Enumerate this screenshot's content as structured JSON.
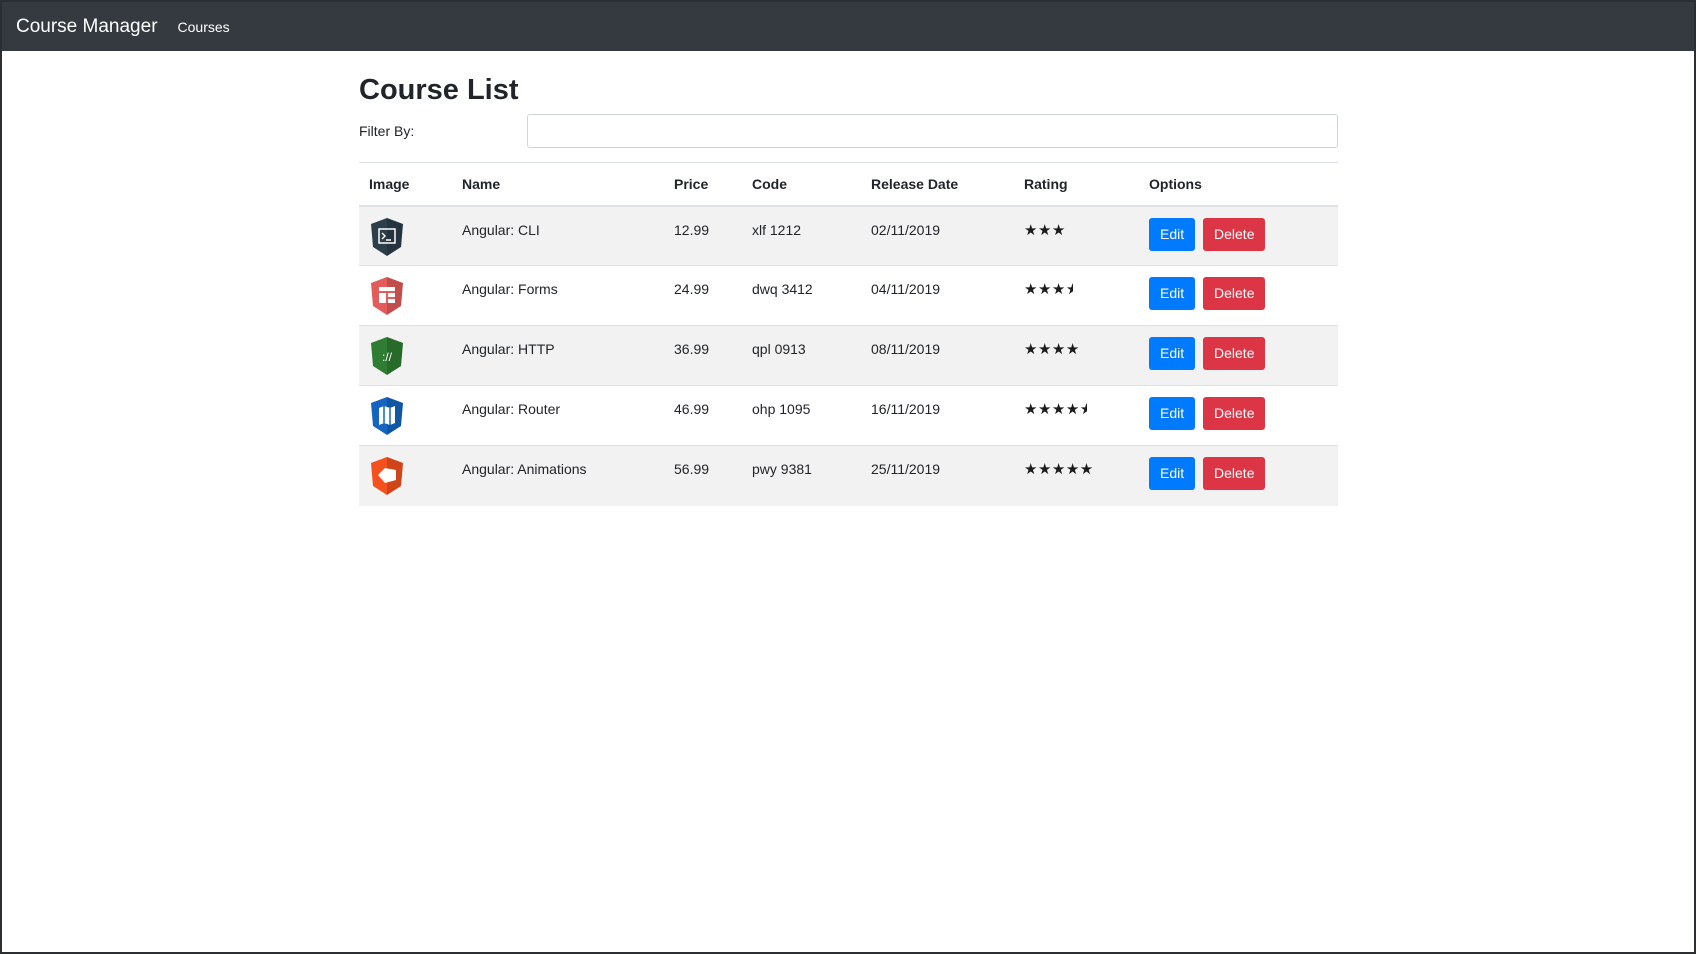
{
  "nav": {
    "brand": "Course Manager",
    "courses_link": "Courses"
  },
  "page": {
    "title": "Course List",
    "filter_label": "Filter By:",
    "filter_value": ""
  },
  "table": {
    "headers": [
      "Image",
      "Name",
      "Price",
      "Code",
      "Release Date",
      "Rating",
      "Options"
    ],
    "rows": [
      {
        "icon": "terminal-shield-icon",
        "color": "#2c3e4a",
        "glyph": ">_",
        "name": "Angular: CLI",
        "price": "12.99",
        "code": "xlf 1212",
        "date": "02/11/2019",
        "rating": 3
      },
      {
        "icon": "forms-shield-icon",
        "color": "#e35b5b",
        "glyph": "▤",
        "name": "Angular: Forms",
        "price": "24.99",
        "code": "dwq 3412",
        "date": "04/11/2019",
        "rating": 3.5
      },
      {
        "icon": "http-shield-icon",
        "color": "#2e7d32",
        "glyph": "://",
        "name": "Angular: HTTP",
        "price": "36.99",
        "code": "qpl 0913",
        "date": "08/11/2019",
        "rating": 4
      },
      {
        "icon": "router-shield-icon",
        "color": "#1565c0",
        "glyph": "▯▯",
        "name": "Angular: Router",
        "price": "46.99",
        "code": "ohp 1095",
        "date": "16/11/2019",
        "rating": 4.5
      },
      {
        "icon": "animations-shield-icon",
        "color": "#f4511e",
        "glyph": "◆",
        "name": "Angular: Animations",
        "price": "56.99",
        "code": "pwy 9381",
        "date": "25/11/2019",
        "rating": 5
      }
    ],
    "edit_label": "Edit",
    "delete_label": "Delete"
  },
  "colors": {
    "navbar": "#343a40",
    "edit": "#007bff",
    "delete": "#dc3545",
    "stripe": "#f2f2f2"
  }
}
